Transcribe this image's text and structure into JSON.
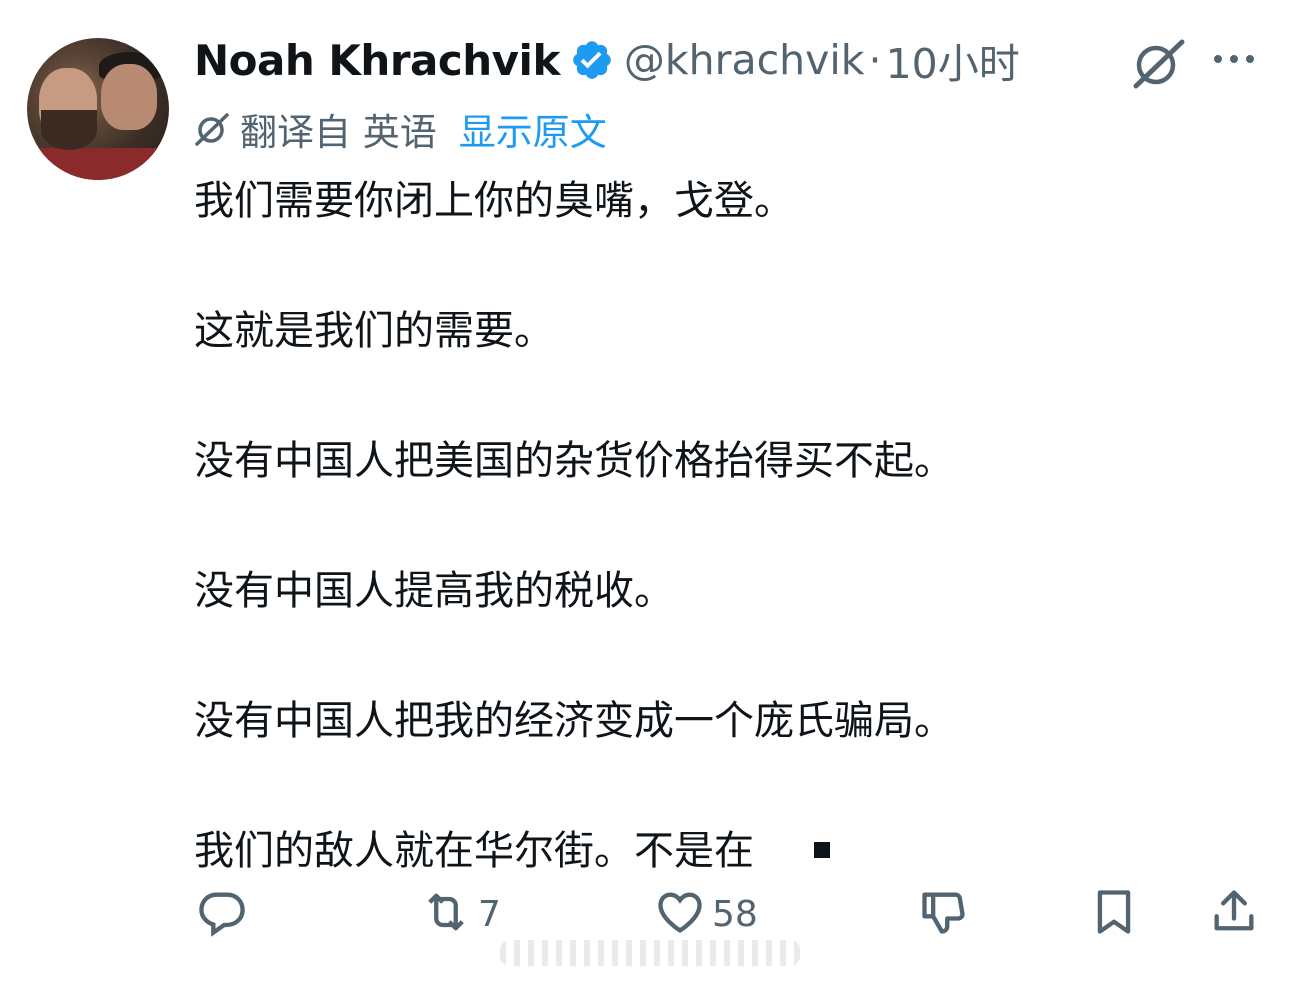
{
  "author": {
    "name": "Noah Khrachvik",
    "handle": "@khrachvik",
    "separator": "·",
    "time": "10小时",
    "verified": true,
    "verified_color": "#1d9bf0"
  },
  "translation": {
    "translated_from": "翻译自 英语",
    "show_original": "显示原文",
    "link_color": "#1d9bf0"
  },
  "body": {
    "paragraphs": [
      "我们需要你闭上你的臭嘴，戈登。",
      "这就是我们的需要。",
      "没有中国人把美国的杂货价格抬得买不起。",
      "没有中国人提高我的税收。",
      "没有中国人把我的经济变成一个庞氏骗局。",
      "我们的敌人就在华尔街。不是在"
    ]
  },
  "actions": {
    "reply": {
      "icon": "reply-icon",
      "count": ""
    },
    "retweet": {
      "icon": "retweet-icon",
      "count": "7"
    },
    "like": {
      "icon": "heart-icon",
      "count": "58"
    },
    "dislike": {
      "icon": "thumbs-down-icon",
      "count": ""
    },
    "bookmark": {
      "icon": "bookmark-icon",
      "count": ""
    },
    "share": {
      "icon": "share-icon",
      "count": ""
    }
  },
  "colors": {
    "text_primary": "#0f1419",
    "text_secondary": "#536471",
    "accent": "#1d9bf0"
  }
}
